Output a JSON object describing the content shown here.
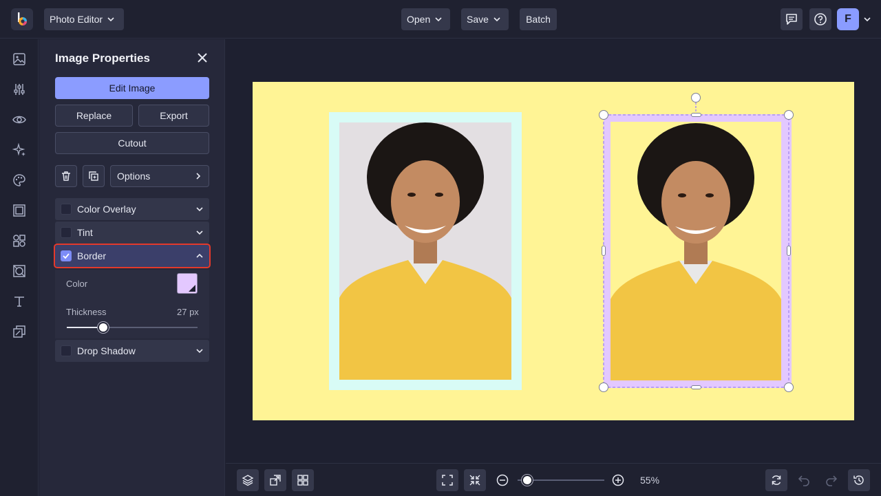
{
  "topbar": {
    "app_menu_label": "Photo Editor",
    "open_label": "Open",
    "save_label": "Save",
    "batch_label": "Batch",
    "avatar_initial": "F"
  },
  "panel": {
    "title": "Image Properties",
    "edit_image_label": "Edit Image",
    "replace_label": "Replace",
    "export_label": "Export",
    "cutout_label": "Cutout",
    "options_label": "Options",
    "sections": [
      {
        "label": "Color Overlay",
        "checked": false
      },
      {
        "label": "Tint",
        "checked": false
      },
      {
        "label": "Border",
        "checked": true
      },
      {
        "label": "Drop Shadow",
        "checked": false
      }
    ],
    "border": {
      "color_label": "Color",
      "color_value": "#e3c8ff",
      "thickness_label": "Thickness",
      "thickness_value": "27 px"
    }
  },
  "canvas": {
    "background_color": "#fff495",
    "left_border_color": "#d8fbf6",
    "right_border_color": "#e3c8ff"
  },
  "bottombar": {
    "zoom_label": "55%"
  }
}
